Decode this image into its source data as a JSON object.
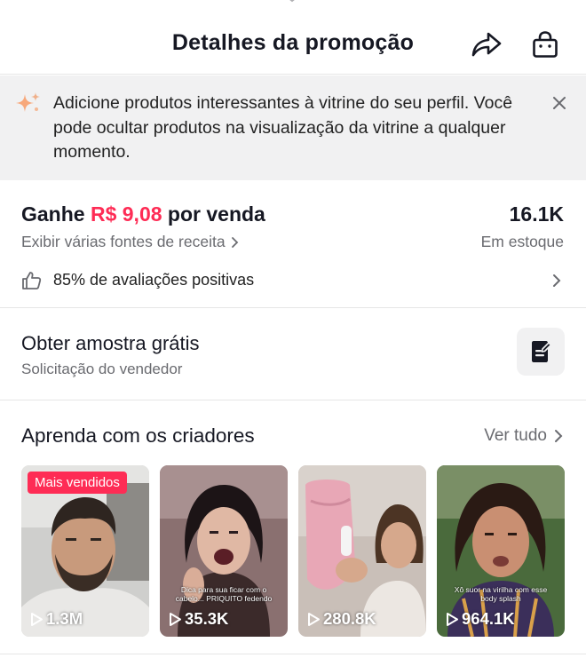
{
  "header": {
    "title": "Detalhes da promoção"
  },
  "tip": {
    "text": "Adicione produtos interessantes à vitrine do seu perfil. Você pode ocultar produtos na visualização da vitrine a qualquer momento."
  },
  "earnings": {
    "prefix": "Ganhe",
    "amount": "R$ 9,08",
    "suffix": "por venda",
    "revenue_link": "Exibir várias fontes de receita"
  },
  "stock": {
    "value": "16.1K",
    "label": "Em estoque"
  },
  "rating": {
    "text": "85% de avaliações positivas"
  },
  "sample": {
    "title": "Obter amostra grátis",
    "subtitle": "Solicitação do vendedor"
  },
  "creators": {
    "title": "Aprenda com os criadores",
    "see_all": "Ver tudo",
    "videos": [
      {
        "badge": "Mais vendidos",
        "caption": "",
        "views": "1.3M"
      },
      {
        "badge": "",
        "caption": "Dica para sua ficar com o cabelo... PRIQUITO fedendo",
        "views": "35.3K"
      },
      {
        "badge": "",
        "caption": "",
        "views": "280.8K"
      },
      {
        "badge": "",
        "caption": "Xô suor na virilha com esse body splash",
        "views": "964.1K"
      }
    ]
  },
  "colors": {
    "accent": "#fe2c55",
    "muted_text": "#6a6b70",
    "tip_background": "#f1f1f2"
  }
}
